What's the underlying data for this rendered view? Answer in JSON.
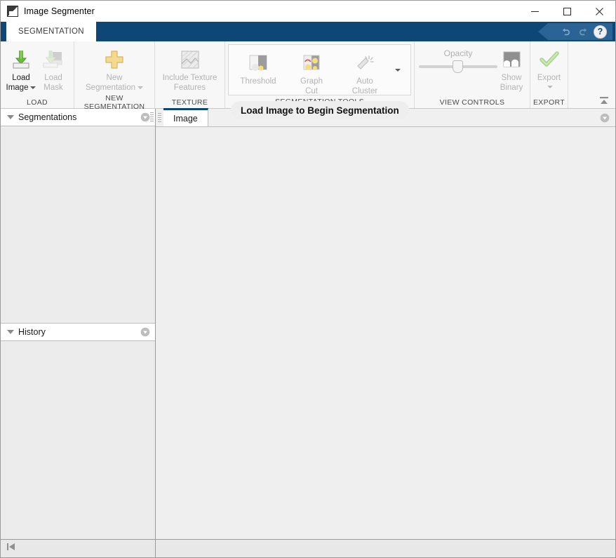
{
  "window": {
    "title": "Image Segmenter",
    "app_icon": "image-segmenter-icon",
    "minimize_label": "Minimize",
    "maximize_label": "Maximize",
    "close_label": "Close"
  },
  "tabstrip": {
    "tabs": [
      {
        "label": "SEGMENTATION",
        "active": true
      }
    ],
    "quick_access": [
      {
        "name": "undo-icon",
        "label": "Undo"
      },
      {
        "name": "redo-icon",
        "label": "Redo"
      },
      {
        "name": "help-icon",
        "label": "?"
      }
    ]
  },
  "ribbon": {
    "groups": [
      {
        "title": "LOAD",
        "buttons": [
          {
            "label_line1": "Load",
            "label_line2": "Image",
            "icon": "load-image-icon",
            "has_dropdown": true,
            "disabled": false
          },
          {
            "label_line1": "Load",
            "label_line2": "Mask",
            "icon": "load-mask-icon",
            "has_dropdown": false,
            "disabled": true
          }
        ]
      },
      {
        "title": "NEW SEGMENTATION",
        "buttons": [
          {
            "label_line1": "New",
            "label_line2": "Segmentation",
            "icon": "new-segmentation-icon",
            "has_dropdown": true,
            "disabled": true
          }
        ]
      },
      {
        "title": "TEXTURE",
        "buttons": [
          {
            "label_line1": "Include Texture",
            "label_line2": "Features",
            "icon": "texture-features-icon",
            "has_dropdown": false,
            "disabled": true
          }
        ]
      },
      {
        "title": "SEGMENTATION TOOLS",
        "buttons": [
          {
            "label_line1": "Threshold",
            "label_line2": "",
            "icon": "threshold-icon",
            "has_dropdown": false,
            "disabled": true
          },
          {
            "label_line1": "Graph",
            "label_line2": "Cut",
            "icon": "graph-cut-icon",
            "has_dropdown": false,
            "disabled": true
          },
          {
            "label_line1": "Auto",
            "label_line2": "Cluster",
            "icon": "auto-cluster-icon",
            "has_dropdown": false,
            "disabled": true
          }
        ]
      },
      {
        "title": "VIEW CONTROLS",
        "opacity": {
          "label": "Opacity",
          "value": 50
        },
        "buttons": [
          {
            "label_line1": "Show",
            "label_line2": "Binary",
            "icon": "show-binary-icon",
            "has_dropdown": false,
            "disabled": true
          }
        ]
      },
      {
        "title": "EXPORT",
        "buttons": [
          {
            "label_line1": "Export",
            "label_line2": "",
            "icon": "export-icon",
            "has_dropdown": true,
            "disabled": true
          }
        ]
      }
    ],
    "collapse_icon": "ribbon-collapse-icon",
    "tooltip_banner": "Load Image to Begin Segmentation"
  },
  "sidebar": {
    "panels": [
      {
        "title": "Segmentations",
        "collapse_icon": "panel-collapse-icon",
        "close_icon": "panel-close-icon"
      },
      {
        "title": "History",
        "collapse_icon": "panel-collapse-icon",
        "close_icon": "panel-close-icon"
      }
    ]
  },
  "document": {
    "tabs": [
      {
        "label": "Image",
        "active": true
      }
    ],
    "close_icon": "document-close-icon"
  },
  "statusbar": {
    "nav_icon": "go-to-start-icon",
    "text": ""
  },
  "colors": {
    "ribbon_tab_bar": "#0e4775",
    "quick_access_banner": "#2b6394",
    "ribbon_bg": "#f7f7f7",
    "panel_bg": "#ececec",
    "canvas_bg": "#efefef",
    "accent_green": "#78b43c",
    "disabled_text": "#b3b3b3"
  }
}
